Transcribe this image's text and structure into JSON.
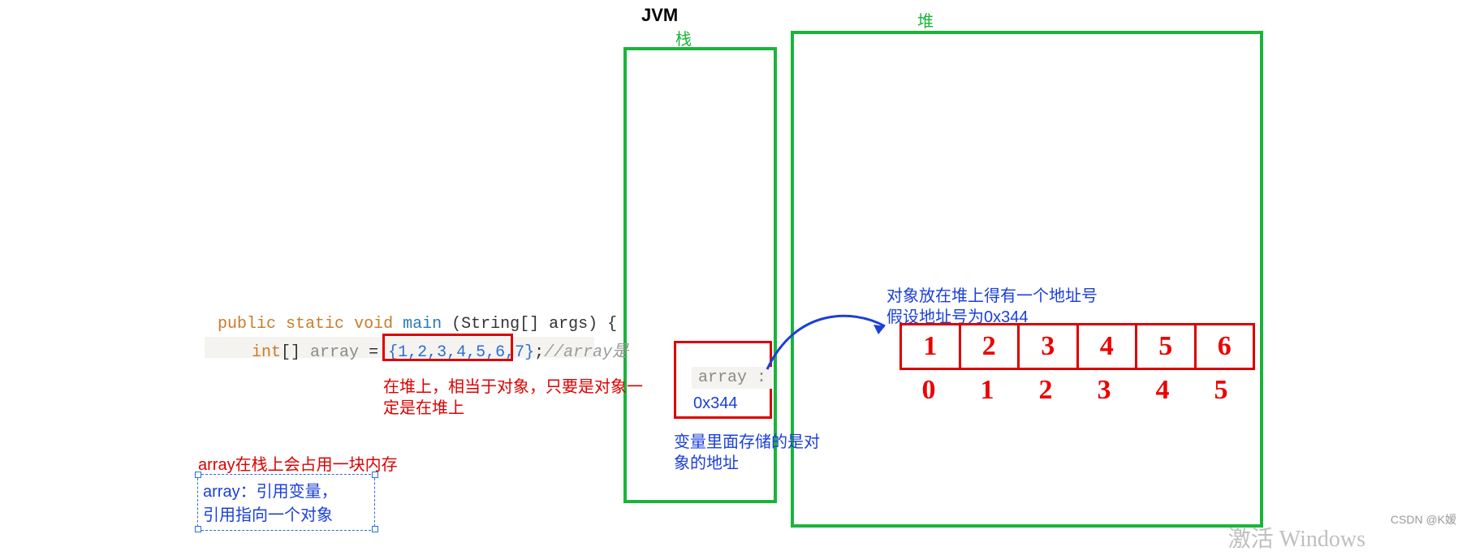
{
  "labels": {
    "jvm": "JVM",
    "stack": "栈",
    "heap": "堆"
  },
  "code": {
    "kw_public": "public",
    "kw_static": "static",
    "kw_void": "void",
    "method": "main",
    "params_open": "(String[] args) {",
    "indent_int": "int",
    "brackets": "[]",
    "var": "array",
    "eq": " = ",
    "vals_open": "{",
    "vals": "1,2,3,4,5,6,7",
    "vals_close": "}",
    "semi": ";",
    "comment": "//array是",
    "bg_hint": "{1,2,3,4,5,6,7}"
  },
  "notes": {
    "heap_note_line1": "在堆上，相当于对象，只要是对象一",
    "heap_note_line2": "定是在堆上",
    "stack_note": "array在栈上会占用一块内存",
    "ref_note_line1": "array：引用变量，",
    "ref_note_line2": "引用指向一个对象",
    "stack_box_var": "array :",
    "stack_box_addr": "0x344",
    "stack_store_line1": "变量里面存储的是对",
    "stack_store_line2": "象的地址",
    "heap_obj_line1": "对象放在堆上得有一个地址号",
    "heap_obj_line2": "假设地址号为0x344"
  },
  "heap_cells": [
    "1",
    "2",
    "3",
    "4",
    "5",
    "6"
  ],
  "heap_indices": [
    "0",
    "1",
    "2",
    "3",
    "4",
    "5"
  ],
  "watermark": {
    "activate": "激活 Windows",
    "csdn": "CSDN @K嫒"
  }
}
